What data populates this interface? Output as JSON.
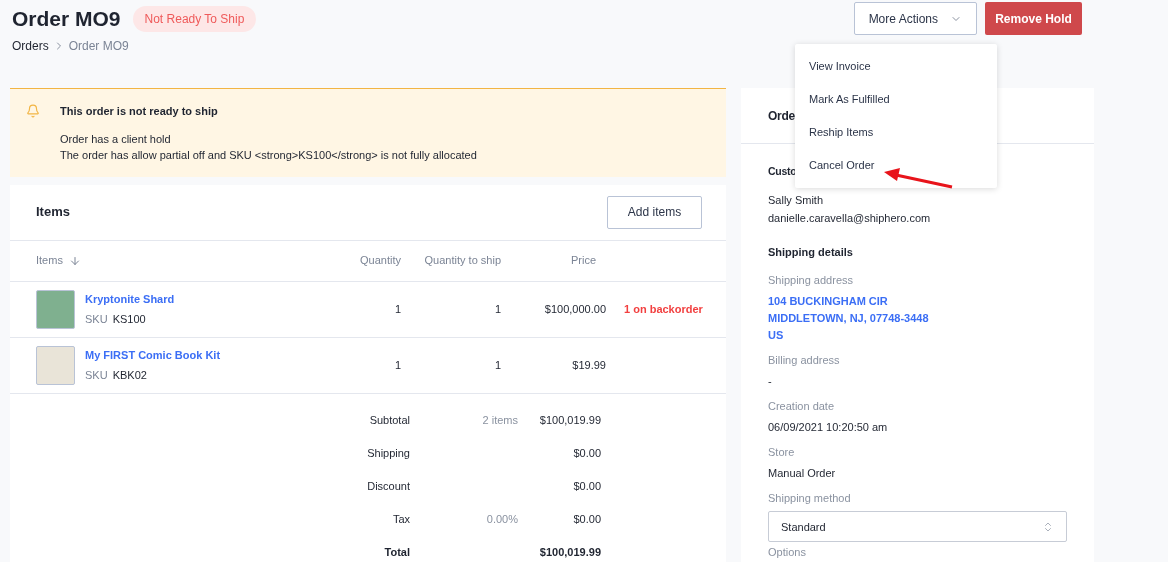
{
  "header": {
    "title": "Order MO9",
    "status_badge": "Not Ready To Ship",
    "breadcrumbs": [
      {
        "label": "Orders"
      },
      {
        "label": "Order MO9"
      }
    ],
    "more_actions": "More Actions",
    "remove_hold": "Remove Hold"
  },
  "alert": {
    "title": "This order is not ready to ship",
    "lines": [
      "Order has a client hold",
      "The order has allow partial off and SKU <strong>KS100</strong> is not fully allocated"
    ]
  },
  "items": {
    "title": "Items",
    "add_button": "Add items",
    "columns": [
      "Items",
      "Quantity",
      "Quantity to ship",
      "Price"
    ],
    "rows": [
      {
        "name": "Kryptonite Shard",
        "sku_label": "SKU",
        "sku": "KS100",
        "quantity": "1",
        "quantity_to_ship": "1",
        "price": "$100,000.00",
        "status": "1 on backorder"
      },
      {
        "name": "My FIRST Comic Book Kit",
        "sku_label": "SKU",
        "sku": "KBK02",
        "quantity": "1",
        "quantity_to_ship": "1",
        "price": "$19.99"
      }
    ],
    "totals": [
      {
        "label": "Subtotal",
        "note": "2 items",
        "value": "$100,019.99",
        "bold": false
      },
      {
        "label": "Shipping",
        "value": "$0.00",
        "bold": false
      },
      {
        "label": "Discount",
        "value": "$0.00",
        "bold": false
      },
      {
        "label": "Tax",
        "note": "0.00%",
        "value": "$0.00",
        "bold": false
      },
      {
        "label": "Total",
        "value": "$100,019.99",
        "bold": true
      }
    ]
  },
  "side_panel": {
    "title": "Orde",
    "customer_heading": "Custo",
    "customer_name": "Sally Smith",
    "customer_email": "danielle.caravella@shiphero.com",
    "shipping_heading": "Shipping details",
    "shipping_address_label": "Shipping address",
    "shipping_address": [
      "104 BUCKINGHAM CIR",
      "MIDDLETOWN, NJ, 07748-3448",
      "US"
    ],
    "fields": [
      {
        "label": "Billing address",
        "value": "-"
      },
      {
        "label": "Creation date",
        "value": "06/09/2021 10:20:50 am"
      },
      {
        "label": "Store",
        "value": "Manual Order"
      }
    ],
    "shipping_method_label": "Shipping method",
    "shipping_method": "Standard",
    "options_label": "Options"
  },
  "menu": {
    "items": [
      {
        "label": "View Invoice"
      },
      {
        "label": "Mark As Fulfilled"
      },
      {
        "label": "Reship Items"
      },
      {
        "label": "Cancel Order"
      }
    ]
  }
}
